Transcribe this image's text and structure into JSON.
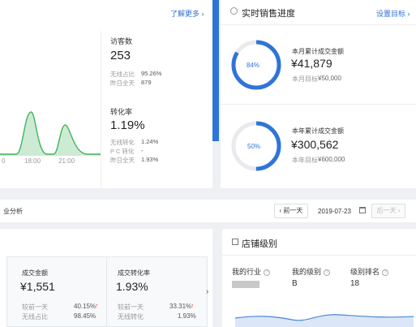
{
  "traffic": {
    "more_link": "了解更多 ›",
    "visitors": {
      "label": "访客数",
      "value": "253",
      "rows": [
        {
          "k": "无线占比",
          "v": "95.26%"
        },
        {
          "k": "昨日全天",
          "v": "879"
        }
      ]
    },
    "conversion": {
      "label": "转化率",
      "value": "1.19%",
      "rows": [
        {
          "k": "无线转化",
          "v": "1.24%"
        },
        {
          "k": "P C 转化",
          "v": "-"
        },
        {
          "k": "昨日全天",
          "v": "1.93%"
        }
      ]
    },
    "x_ticks": [
      "0",
      "18:00",
      "21:00"
    ]
  },
  "sales": {
    "title": "实时销售进度",
    "settings_link": "设置目标 ›",
    "month": {
      "percent": "84%",
      "pct_value": 0.84,
      "label": "本月累计成交金额",
      "amount": "¥41,879",
      "target_label": "本月目标",
      "target_value": "¥50,000"
    },
    "year": {
      "percent": "50%",
      "pct_value": 0.5,
      "label": "本年累计成交金额",
      "amount": "¥300,562",
      "target_label": "本年目标",
      "target_value": "¥600,000"
    },
    "ring_color": "#2f74d8"
  },
  "analysis": {
    "title": "业分析",
    "prev_btn": "‹ 前一天",
    "date": "2019-07-23",
    "next_btn": "后一天 ›"
  },
  "cards": [
    {
      "label": "成交金额",
      "value": "¥1,551",
      "rows": [
        {
          "k": "较前一天",
          "v": "40.15%",
          "arrow": "↑"
        },
        {
          "k": "无线占比",
          "v": "98.45%",
          "arrow": ""
        }
      ]
    },
    {
      "label": "成交转化率",
      "value": "1.93%",
      "rows": [
        {
          "k": "较前一天",
          "v": "33.31%",
          "arrow": "↑"
        },
        {
          "k": "无线转化",
          "v": "1.93%",
          "arrow": ""
        }
      ]
    }
  ],
  "store_level": {
    "title": "店铺级别",
    "cols": [
      {
        "label": "我的行业",
        "value": ""
      },
      {
        "label": "我的级别",
        "value": "B"
      },
      {
        "label": "级别排名",
        "value": "18"
      }
    ]
  }
}
